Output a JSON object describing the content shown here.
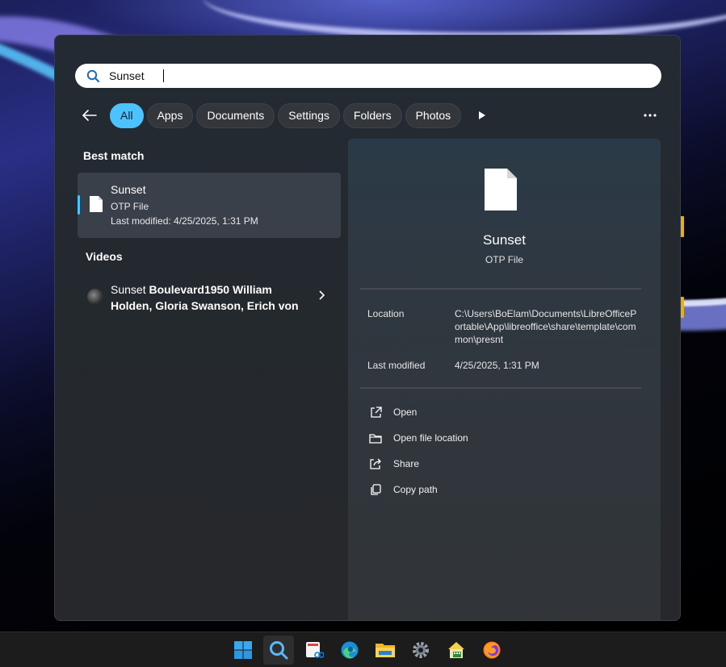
{
  "search": {
    "query": "Sunset"
  },
  "filters": {
    "back_icon": "arrow-left-icon",
    "chips": [
      {
        "label": "All",
        "active": true
      },
      {
        "label": "Apps",
        "active": false
      },
      {
        "label": "Documents",
        "active": false
      },
      {
        "label": "Settings",
        "active": false
      },
      {
        "label": "Folders",
        "active": false
      },
      {
        "label": "Photos",
        "active": false
      }
    ],
    "more_icon": "more-horizontal-icon",
    "play_icon": "play-icon"
  },
  "results": {
    "best_match_title": "Best match",
    "best_match": {
      "name": "Sunset",
      "type": "OTP File",
      "modified": "Last modified: 4/25/2025, 1:31 PM"
    },
    "videos_title": "Videos",
    "video": {
      "prefix": "Sunset",
      "rest": " Boulevard1950 William Holden, Gloria Swanson, Erich von"
    }
  },
  "preview": {
    "title": "Sunset",
    "subtitle": "OTP File",
    "location_label": "Location",
    "location_value": "C:\\Users\\BoElam\\Documents\\LibreOfficePortable\\App\\libreoffice\\share\\template\\common\\presnt",
    "modified_label": "Last modified",
    "modified_value": "4/25/2025, 1:31 PM",
    "actions": [
      {
        "label": "Open",
        "icon": "open-external-icon"
      },
      {
        "label": "Open file location",
        "icon": "folder-icon"
      },
      {
        "label": "Share",
        "icon": "share-icon"
      },
      {
        "label": "Copy path",
        "icon": "copy-icon"
      }
    ]
  },
  "taskbar": {
    "items": [
      "windows-start-icon",
      "search-icon",
      "snipping-tool-icon",
      "edge-icon",
      "file-explorer-icon",
      "settings-icon",
      "network-app-icon",
      "firefox-icon"
    ]
  },
  "colors": {
    "accent": "#4cc2ff"
  }
}
